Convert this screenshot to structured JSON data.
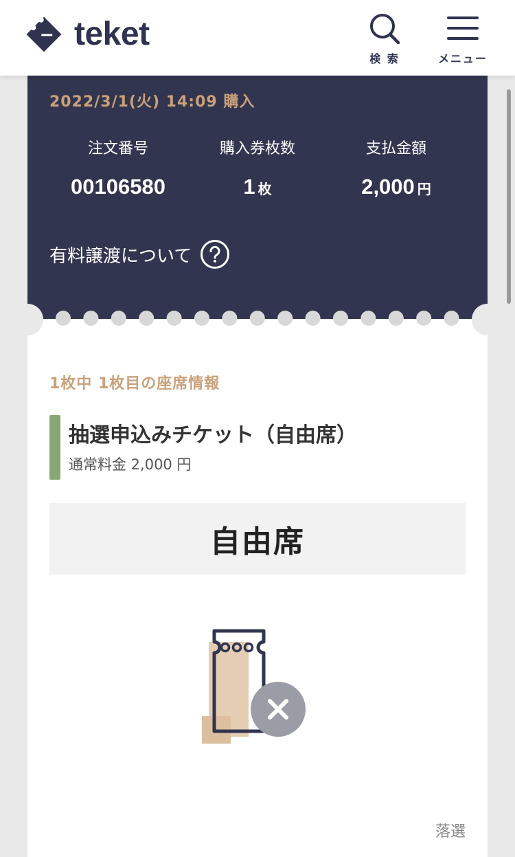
{
  "header": {
    "logo_text": "teket",
    "search_label": "検 索",
    "menu_label": "メニュー"
  },
  "order": {
    "purchase_datetime": "2022/3/1(火) 14:09 購入",
    "order_number_label": "注文番号",
    "order_number": "00106580",
    "ticket_count_label": "購入券枚数",
    "ticket_count": "1",
    "ticket_count_unit": "枚",
    "amount_label": "支払金額",
    "amount": "2,000",
    "amount_unit": "円",
    "transfer_link": "有料譲渡について"
  },
  "seat": {
    "position_text": "1枚中 1枚目の座席情報",
    "ticket_name": "抽選申込みチケット（自由席）",
    "ticket_price": "通常料金 2,000 円",
    "seat_type": "自由席",
    "result_status": "落選"
  },
  "colors": {
    "brand_navy": "#2f3350",
    "card_dark": "#32354f",
    "accent_gold": "#c9a27a",
    "green_bar": "#86a873",
    "status_grey": "#9a9ca6"
  },
  "icons": [
    "ticket-logo-icon",
    "search-icon",
    "hamburger-menu-icon",
    "question-icon",
    "lost-ticket-icon"
  ]
}
